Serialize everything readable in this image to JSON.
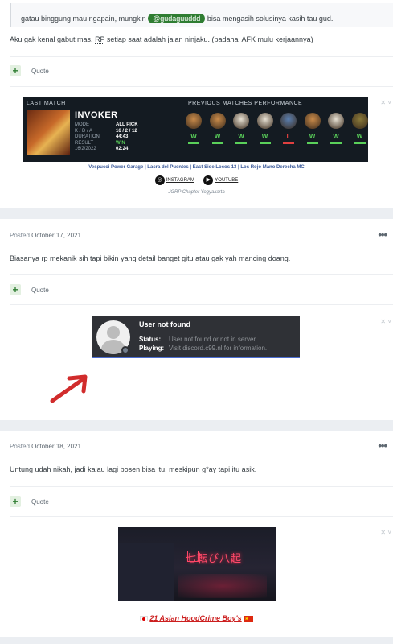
{
  "post1": {
    "quote_text_before": "gatau binggung mau ngapain, mungkin ",
    "mention": "@gudaguuddd",
    "quote_text_after": " bisa mengasih solusinya kasih tau gud.",
    "body_before": "Aku gak kenal gabut mas, ",
    "body_abbr": "RP",
    "body_after": " setiap saat adalah jalan ninjaku. (padahal AFK mulu kerjaannya)",
    "quote_label": "Quote",
    "signature": {
      "last_match_label": "LAST MATCH",
      "hero_name": "INVOKER",
      "stat_labels": [
        "MODE",
        "K / D / A",
        "DURATION",
        "RESULT"
      ],
      "stat_values": [
        "ALL PICK",
        "16 / 2 / 12",
        "44:43",
        "WIN"
      ],
      "date": "16/2/2022",
      "time": "02:24",
      "previous_label": "PREVIOUS MATCHES PERFORMANCE",
      "previous_results": [
        "W",
        "W",
        "W",
        "W",
        "L",
        "W",
        "W",
        "W"
      ],
      "win_color": "#5ad05a",
      "loss_color": "#e04040",
      "teams_line": "Vespucci Power Garage | Lacra del Puentes | East Side Locos 13 | Los Rojo Mano Derecha MC",
      "instagram_label": "INSTAGRAM",
      "separator": "-",
      "youtube_label": "YOUTUBE",
      "chapter": "JGRP Chapter Yogyakarta"
    }
  },
  "post2": {
    "posted_prefix": "Posted ",
    "posted_date": "October 17, 2021",
    "menu": "•••",
    "body": "Biasanya rp mekanik sih tapi bikin yang detail banget gitu atau gak yah mancing doang.",
    "quote_label": "Quote",
    "discord": {
      "name": "User not found",
      "status_label": "Status:",
      "status_value": "User not found or not in server",
      "playing_label": "Playing:",
      "playing_value": "Visit discord.c99.nl for information."
    }
  },
  "post3": {
    "posted_prefix": "Posted ",
    "posted_date": "October 18, 2021",
    "menu": "•••",
    "body": "Untung udah nikah, jadi kalau lagi bosen bisa itu, meskipun g*ay tapi itu asik.",
    "quote_label": "Quote",
    "banner_sign": "七転び八起",
    "crew_name": "21 Asian HoodCrime Boy's"
  },
  "colors": {
    "accent_green": "#2f7d32",
    "discord_bg": "#2f3136",
    "crew_red": "#cc1f1f"
  }
}
